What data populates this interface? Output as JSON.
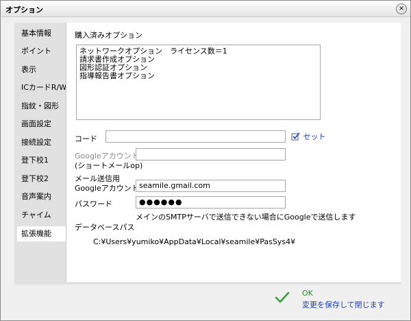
{
  "window": {
    "title": "オプション"
  },
  "sidebar": {
    "items": [
      {
        "label": "基本情報"
      },
      {
        "label": "ポイント"
      },
      {
        "label": "表示"
      },
      {
        "label": "ICカードR/W"
      },
      {
        "label": "指紋・図形"
      },
      {
        "label": "画面設定"
      },
      {
        "label": "接続設定"
      },
      {
        "label": "登下校1"
      },
      {
        "label": "登下校2"
      },
      {
        "label": "音声案内"
      },
      {
        "label": "チャイム"
      },
      {
        "label": "拡張機能"
      }
    ],
    "active_index": 11
  },
  "content": {
    "purchased_title": "購入済みオプション",
    "purchased_options": [
      "ネットワークオプション　ライセンス数＝1",
      "請求書作成オプション",
      "図形認証オプション",
      "指導報告書オプション"
    ],
    "code_label": "コード",
    "code_value": "",
    "set_label": "セット",
    "google_account_label": "Googleアカウント",
    "google_account_sub": "(ショートメールop)",
    "google_account_value": "",
    "mail_label": "メール送信用",
    "mail_google_label": "Googleアカウント",
    "mail_google_value": "seamile.gmail.com",
    "password_label": "パスワード",
    "password_value": "●●●●●●",
    "smtp_note": "メインのSMTPサーバで送信できない場合にGoogleで送信します",
    "db_path_label": "データベースパス",
    "db_path_value": "C:¥Users¥yumiko¥AppData¥Local¥seamile¥PasSys4¥"
  },
  "footer": {
    "ok_label": "OK",
    "ok_sub": "変更を保存して閉じます"
  },
  "colors": {
    "link": "#1a3fb5",
    "ok_green": "#2a8a2a"
  }
}
